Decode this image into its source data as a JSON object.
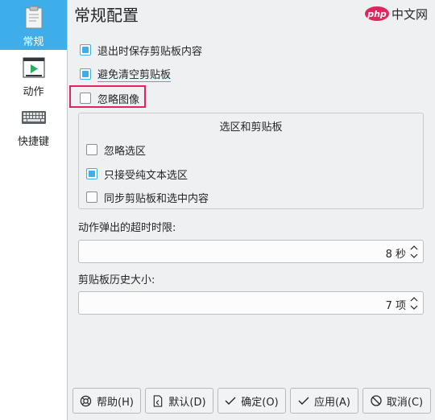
{
  "sidebar": {
    "items": [
      {
        "label": "常规",
        "icon": "general-config-icon",
        "active": true
      },
      {
        "label": "动作",
        "icon": "action-play-icon",
        "active": false
      },
      {
        "label": "快捷键",
        "icon": "keyboard-icon",
        "active": false
      }
    ]
  },
  "header": {
    "title": "常规配置",
    "watermark": "中文网"
  },
  "options": {
    "save_on_exit": "退出时保存剪贴板内容",
    "prevent_empty": "避免清空剪贴板",
    "ignore_images": "忽略图像"
  },
  "selection_group": {
    "title": "选区和剪贴板",
    "ignore_selection": "忽略选区",
    "text_only": "只接受纯文本选区",
    "sync": "同步剪贴板和选中内容"
  },
  "timeout": {
    "label": "动作弹出的超时时限:",
    "value": "8 秒"
  },
  "history": {
    "label": "剪贴板历史大小:",
    "value": "7 项"
  },
  "buttons": {
    "help": "帮助(H)",
    "defaults": "默认(D)",
    "ok": "确定(O)",
    "apply": "应用(A)",
    "cancel": "取消(C)"
  },
  "colors": {
    "accent": "#3daee9",
    "highlight": "#e0245e"
  }
}
